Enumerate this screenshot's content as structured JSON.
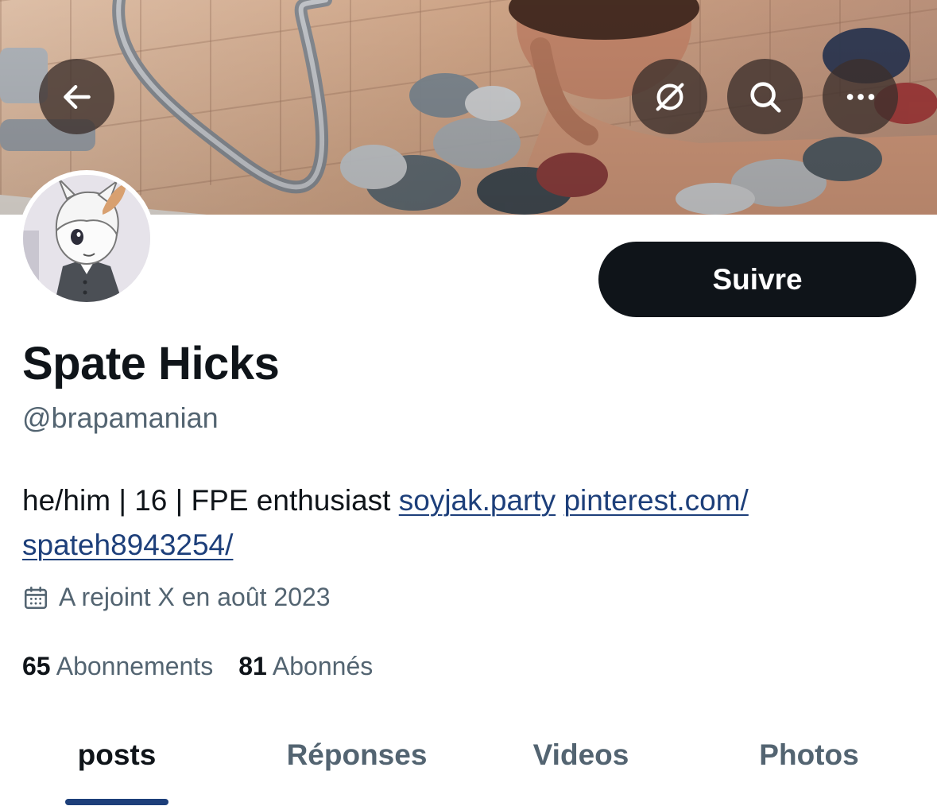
{
  "profile": {
    "display_name": "Spate Hicks",
    "handle": "@brapamanian",
    "bio": {
      "text": "he/him | 16 | FPE enthusiast ",
      "link1": "soyjak.party",
      "link2_part1": "pinterest.com/",
      "link2_part2": "spateh8943254/"
    },
    "joined": "A rejoint X en août 2023",
    "following_count": "65",
    "following_label": "Abonnements",
    "followers_count": "81",
    "followers_label": "Abonnés"
  },
  "actions": {
    "follow_label": "Suivre"
  },
  "header_icons": [
    "back-arrow-icon",
    "translate-icon",
    "search-icon",
    "more-icon"
  ],
  "tabs": [
    {
      "label": "posts",
      "active": true
    },
    {
      "label": "Réponses",
      "active": false
    },
    {
      "label": "Videos",
      "active": false
    },
    {
      "label": "Photos",
      "active": false
    }
  ],
  "colors": {
    "accent": "#1d3f7a",
    "text_primary": "#0f1419",
    "text_secondary": "#536471",
    "follow_button": "#0f1419"
  }
}
